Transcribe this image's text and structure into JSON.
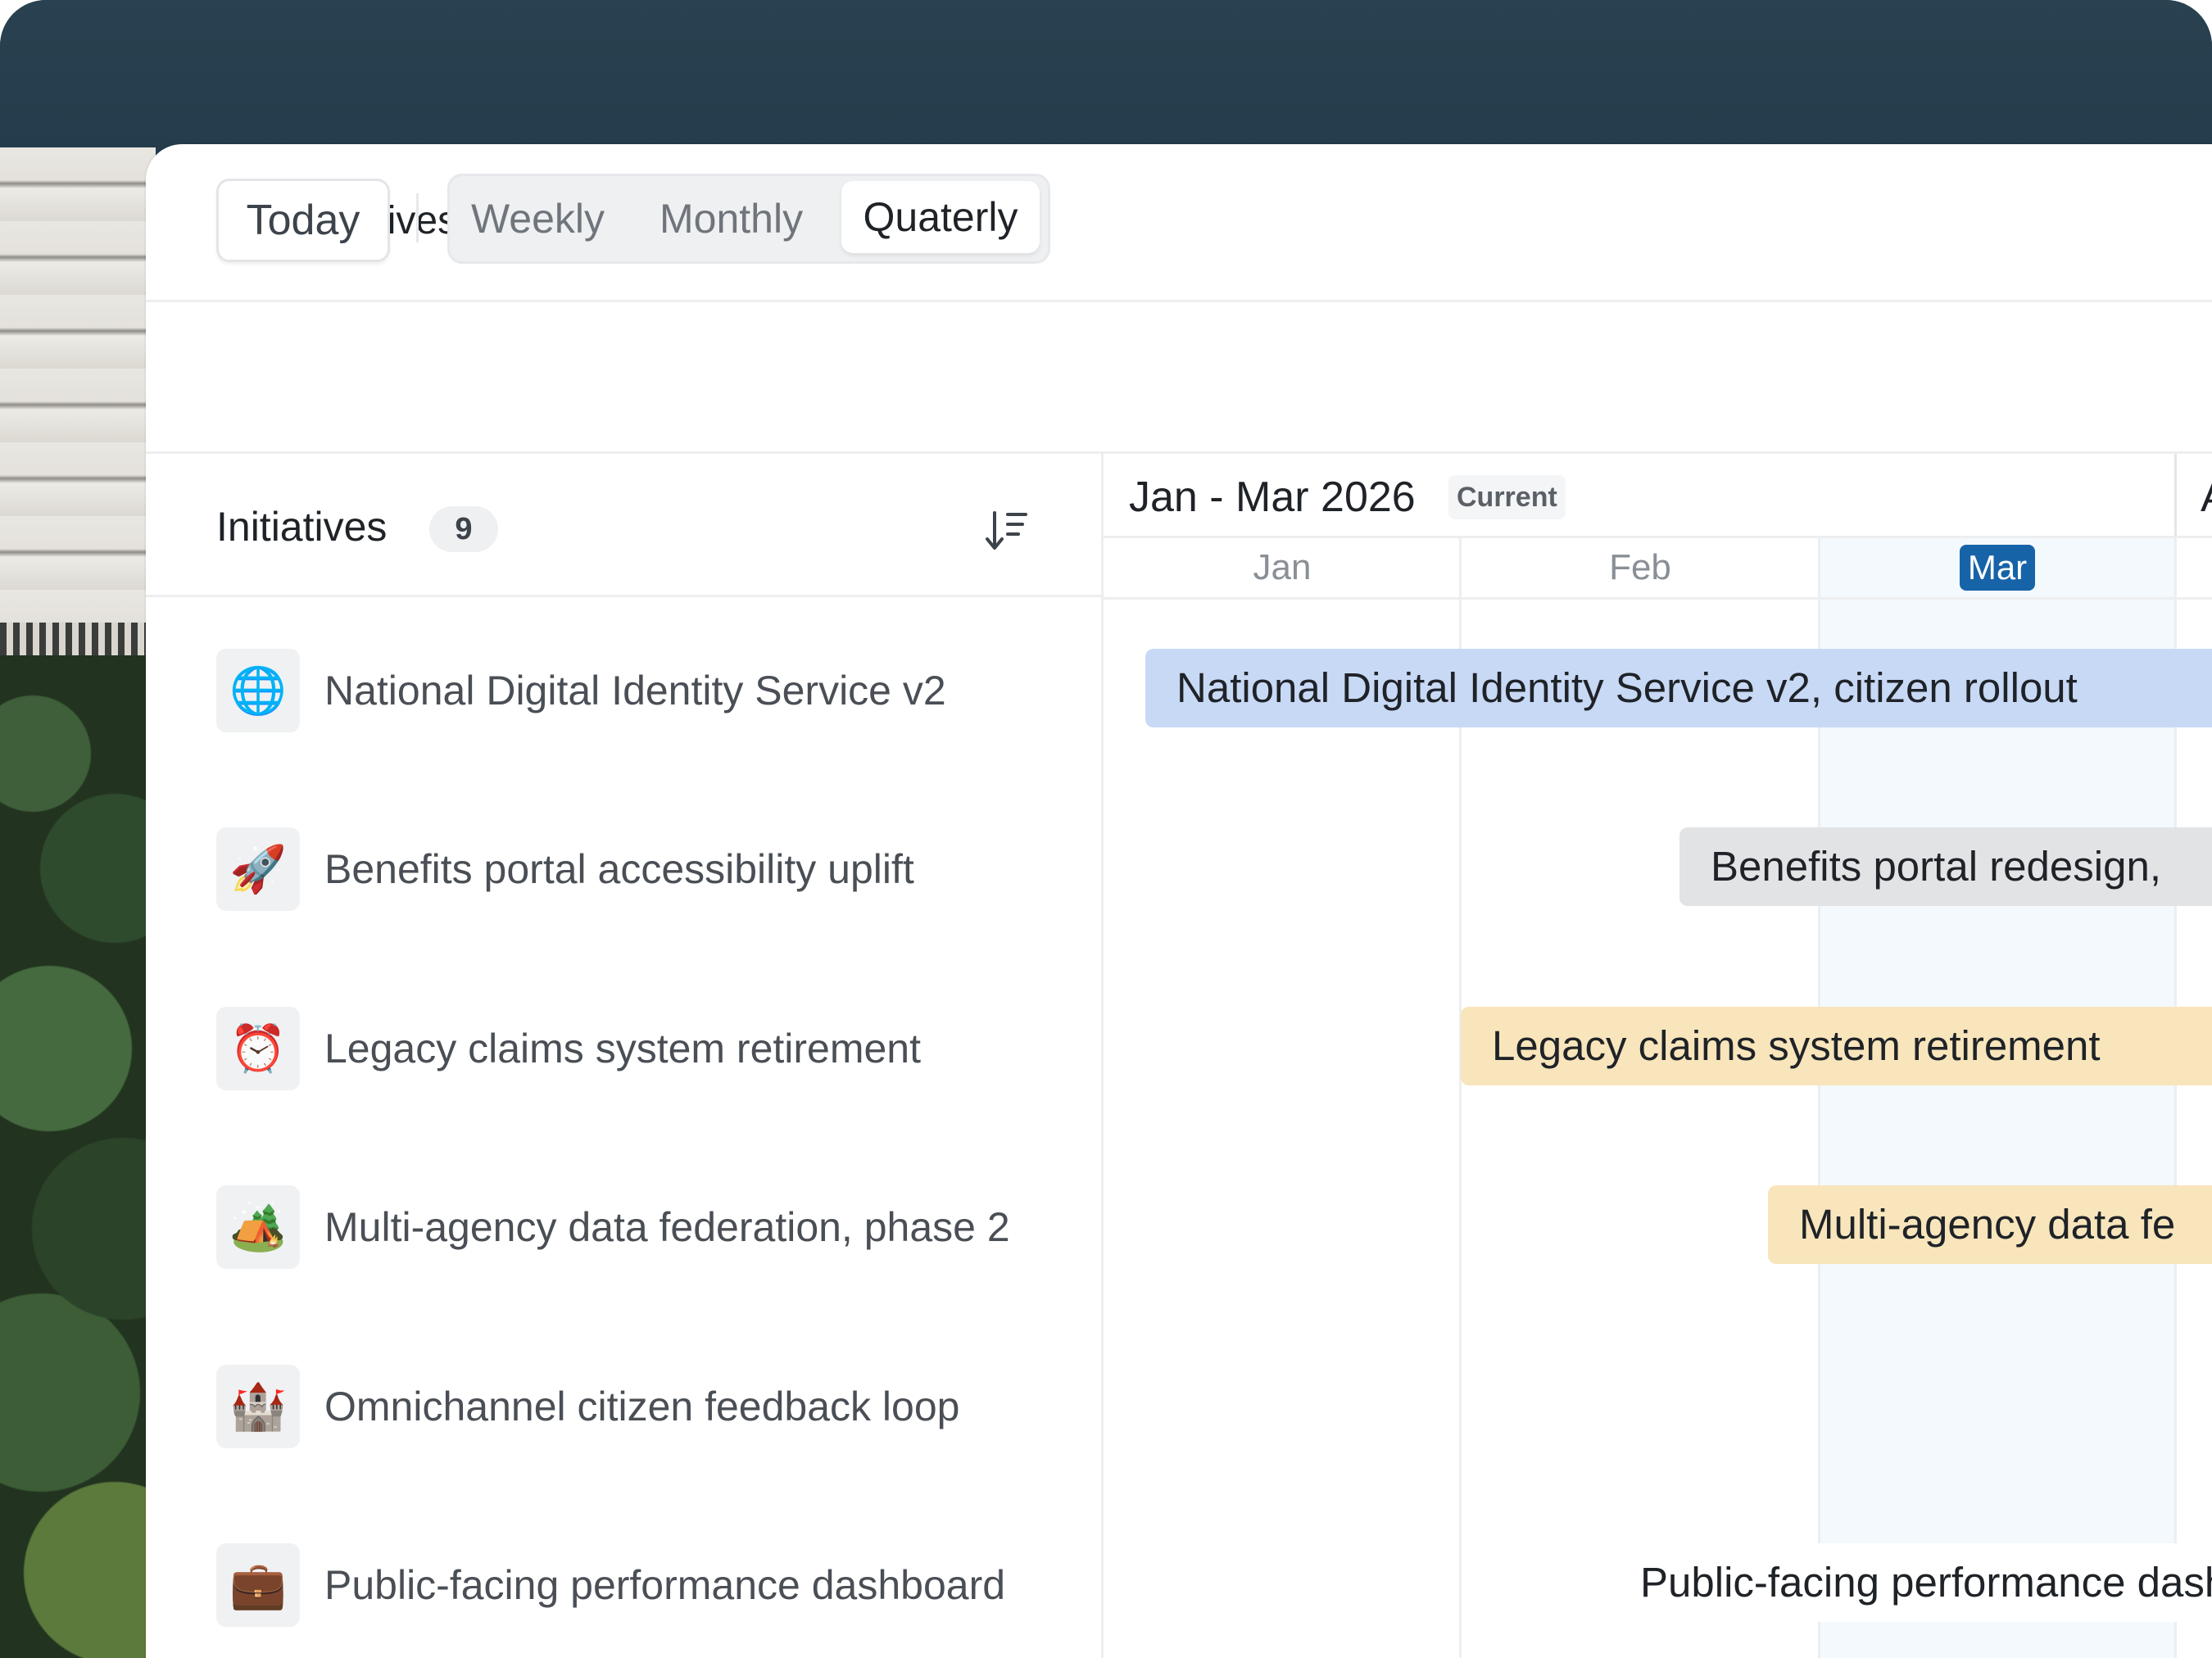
{
  "app": {
    "title": "Initiatives"
  },
  "toolbar": {
    "today_label": "Today",
    "views": [
      "Weekly",
      "Monthly",
      "Quaterly"
    ],
    "active_view": "Quaterly"
  },
  "list": {
    "title": "Initiatives",
    "count": "9",
    "items": [
      {
        "emoji": "🌐",
        "label": "National Digital Identity Service v2"
      },
      {
        "emoji": "🚀",
        "label": "Benefits portal accessibility uplift"
      },
      {
        "emoji": "⏰",
        "label": "Legacy claims system retirement"
      },
      {
        "emoji": "🏕️",
        "label": "Multi-agency data federation, phase 2"
      },
      {
        "emoji": "🏰",
        "label": "Omnichannel citizen feedback loop"
      },
      {
        "emoji": "💼",
        "label": "Public-facing performance dashboard"
      }
    ]
  },
  "timeline": {
    "range_label": "Jan - Mar 2026",
    "current_badge": "Current",
    "next_range_glyph": "A",
    "months": [
      "Jan",
      "Feb",
      "Mar"
    ],
    "current_month": "Mar",
    "bars": [
      {
        "label": "National Digital Identity Service v2, citizen rollout",
        "color": "#c8d9f5"
      },
      {
        "label": "Benefits portal redesign,",
        "color": "#e2e3e5"
      },
      {
        "label": "Legacy claims system retirement",
        "color": "#f8e5bb"
      },
      {
        "label": "Multi-agency data fe",
        "color": "#f8e5bb"
      },
      {
        "label": "Public-facing performance dashb",
        "color": "#ffffff"
      }
    ]
  },
  "colors": {
    "accent": "#1763a8",
    "current_month_bg": "#f3f9fc"
  }
}
